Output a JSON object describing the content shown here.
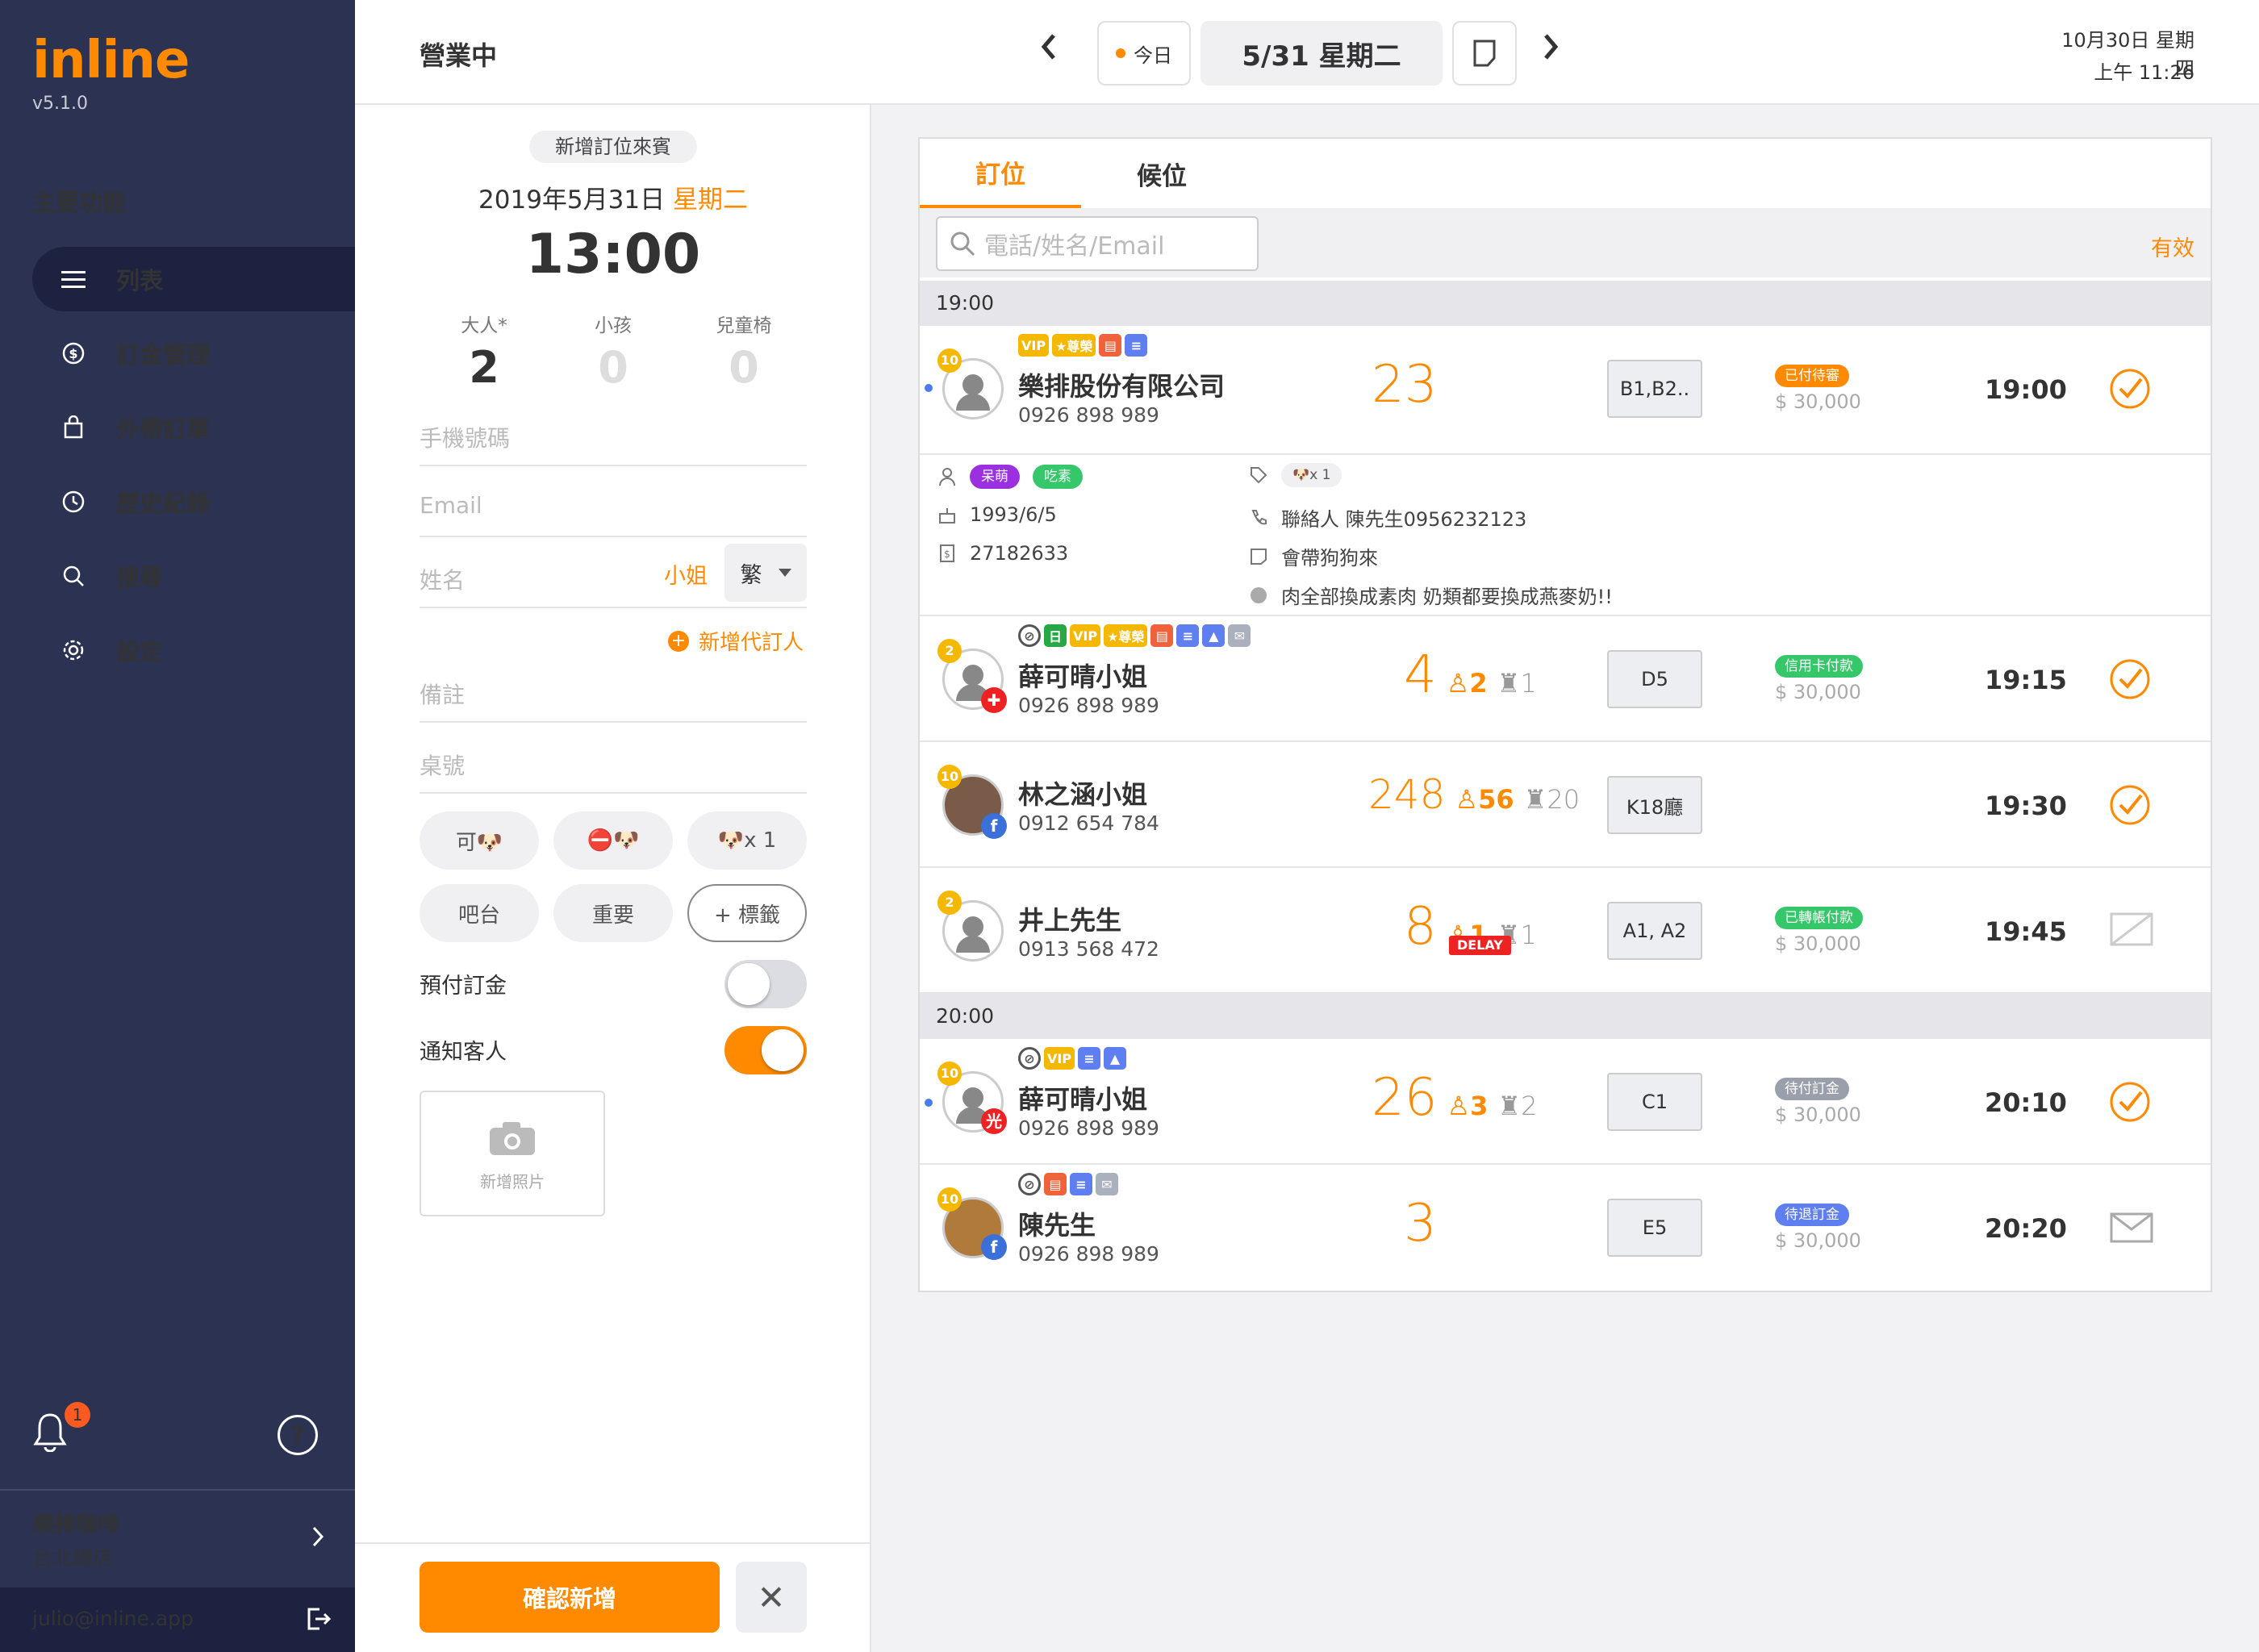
{
  "app": {
    "logo": "inline",
    "version": "v5.1.0"
  },
  "sidebar": {
    "section_title": "主要功能",
    "items": [
      {
        "label": "列表",
        "icon": "list-icon",
        "active": true
      },
      {
        "label": "訂金管理",
        "icon": "dollar-icon",
        "active": false
      },
      {
        "label": "外帶訂單",
        "icon": "bag-icon",
        "active": false
      },
      {
        "label": "歷史紀錄",
        "icon": "clock-icon",
        "active": false
      },
      {
        "label": "搜尋",
        "icon": "search-icon",
        "active": false
      },
      {
        "label": "設定",
        "icon": "gear-icon",
        "active": false
      }
    ],
    "notification_count": "1",
    "help": "?",
    "store_name": "樂排咖啡",
    "branch": "台北總店",
    "user_email": "julio@inline.app"
  },
  "topbar": {
    "status": "營業中",
    "today": "今日",
    "date": "5/31 星期二",
    "clock_date": "10月30日 星期四",
    "clock_time": "上午 11:26"
  },
  "form": {
    "badge": "新增訂位來賓",
    "date": "2019年5月31日",
    "weekday": "星期二",
    "time": "13:00",
    "counters": [
      {
        "label": "大人*",
        "value": "2"
      },
      {
        "label": "小孩",
        "value": "0"
      },
      {
        "label": "兒童椅",
        "value": "0"
      }
    ],
    "phone_placeholder": "手機號碼",
    "email_placeholder": "Email",
    "name_placeholder": "姓名",
    "title": "小姐",
    "lang": "繁",
    "add_agent": "新增代訂人",
    "note_placeholder": "備註",
    "table_placeholder": "桌號",
    "tags": [
      "可🐶",
      "⛔🐶",
      "🐶x 1",
      "吧台",
      "重要",
      "+ 標籤"
    ],
    "prepay_label": "預付訂金",
    "prepay_on": false,
    "notify_label": "通知客人",
    "notify_on": true,
    "add_photo": "新增照片",
    "confirm": "確認新增",
    "cancel": "✕"
  },
  "list": {
    "tabs": [
      "訂位",
      "候位"
    ],
    "search_placeholder": "電話/姓名/Email",
    "filter": "有效",
    "groups": [
      {
        "time": "19:00",
        "rows": [
          {
            "name": "樂排股份有限公司",
            "phone": "0926 898 989",
            "level": "10",
            "party": "23",
            "kids": "",
            "chairs": "",
            "table": "B1,B2..",
            "pay_badge": "已付待審",
            "pay_color": "#ff8a00",
            "amount": "$ 30,000",
            "time": "19:00",
            "state": "check"
          },
          {
            "name": "薛可晴小姐",
            "phone": "0926 898 989",
            "level": "2",
            "party": "4",
            "kids": "2",
            "chairs": "1",
            "table": "D5",
            "pay_badge": "信用卡付款",
            "pay_color": "#36c76a",
            "amount": "$ 30,000",
            "time": "19:15",
            "state": "check"
          },
          {
            "name": "林之涵小姐",
            "phone": "0912 654 784",
            "level": "10",
            "party": "248",
            "kids": "56",
            "chairs": "20",
            "table": "K18廳",
            "pay_badge": "",
            "pay_color": "",
            "amount": "",
            "time": "19:30",
            "state": "check"
          },
          {
            "name": "井上先生",
            "phone": "0913 568 472",
            "level": "2",
            "party": "8",
            "kids": "1",
            "chairs": "1",
            "table": "A1, A2",
            "pay_badge": "已轉帳付款",
            "pay_color": "#36c76a",
            "amount": "$ 30,000",
            "time": "19:45",
            "state": "noseat",
            "delay": "DELAY"
          }
        ]
      },
      {
        "time": "20:00",
        "rows": [
          {
            "name": "薛可晴小姐",
            "phone": "0926 898 989",
            "level": "10",
            "party": "26",
            "kids": "3",
            "chairs": "2",
            "table": "C1",
            "pay_badge": "待付訂金",
            "pay_color": "#9aa0ab",
            "amount": "$ 30,000",
            "time": "20:10",
            "state": "check"
          },
          {
            "name": "陳先生",
            "phone": "0926 898 989",
            "level": "10",
            "party": "3",
            "kids": "",
            "chairs": "",
            "table": "E5",
            "pay_badge": "待退訂金",
            "pay_color": "#5f7ef0",
            "amount": "$ 30,000",
            "time": "20:20",
            "state": "mail"
          }
        ]
      }
    ],
    "detail": {
      "tags": [
        {
          "label": "呆萌",
          "color": "#9b30e0"
        },
        {
          "label": "吃素",
          "color": "#36c76a"
        }
      ],
      "birthday": "1993/6/5",
      "tax_id": "27182633",
      "pet_tag": "🐶x 1",
      "contact": "聯絡人 陳先生0956232123",
      "memo": "會帶狗狗來",
      "request": "肉全部換成素肉 奶類都要換成燕麥奶!!"
    }
  }
}
